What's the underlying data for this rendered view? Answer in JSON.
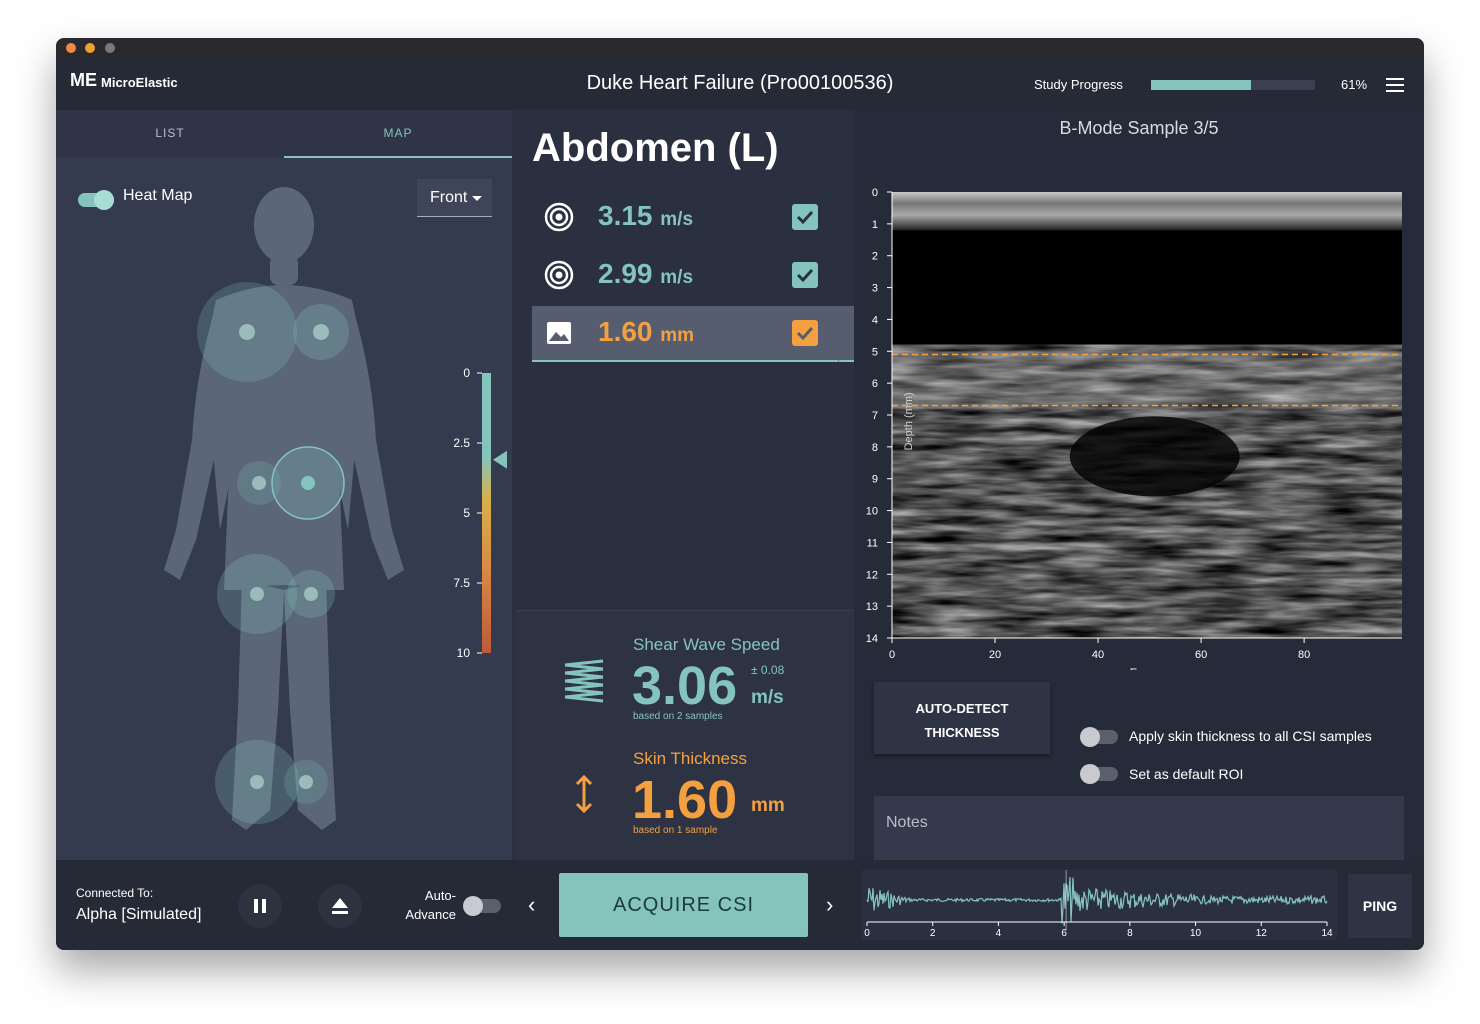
{
  "window": {
    "traffic_colors": [
      "#f08a4b",
      "#f0a030",
      "#7a7a7a"
    ]
  },
  "header": {
    "logo_mark": "ME",
    "brand": "MicroElastic",
    "study_title": "Duke Heart Failure (Pro00100536)",
    "progress_label": "Study Progress",
    "progress_value": 0.61,
    "progress_text": "61%",
    "menu_icon": "hamburger-menu-icon"
  },
  "left": {
    "tabs": [
      {
        "label": "LIST",
        "active": false
      },
      {
        "label": "MAP",
        "active": true
      }
    ],
    "heat_map_label": "Heat Map",
    "heat_map_on": true,
    "view_select": "Front",
    "scale_ticks": [
      "0",
      "2.5",
      "5",
      "7.5",
      "10"
    ],
    "scale_pointer_value": 3.1
  },
  "middle": {
    "region_title": "Abdomen (L)",
    "measurements": [
      {
        "icon": "target-icon",
        "value": "3.15",
        "unit": "m/s",
        "checked": true,
        "active": false
      },
      {
        "icon": "target-icon",
        "value": "2.99",
        "unit": "m/s",
        "checked": true,
        "active": false
      },
      {
        "icon": "image-icon",
        "value": "1.60",
        "unit": "mm",
        "checked": true,
        "active": true
      }
    ],
    "shear": {
      "label": "Shear Wave Speed",
      "value": "3.06",
      "plusminus": "± 0.08",
      "unit": "m/s",
      "note": "based on 2 samples"
    },
    "skin": {
      "label": "Skin Thickness",
      "value": "1.60",
      "unit": "mm",
      "note": "based on 1 sample"
    }
  },
  "right": {
    "chart_title": "B-Mode Sample 3/5",
    "y_ticks": [
      "0",
      "1",
      "2",
      "3",
      "4",
      "5",
      "6",
      "7",
      "8",
      "9",
      "10",
      "11",
      "12",
      "13",
      "14"
    ],
    "x_ticks": [
      "0",
      "20",
      "40",
      "60",
      "80"
    ],
    "x_label": "Frame",
    "y_label": "Depth (mm)",
    "auto_detect_label_1": "AUTO-DETECT",
    "auto_detect_label_2": "THICKNESS",
    "option_1": "Apply skin thickness to all CSI samples",
    "option_2": "Set as default ROI",
    "notes_label": "Notes"
  },
  "chart_data": {
    "type": "heatmap",
    "title": "B-Mode Sample 3/5",
    "xlabel": "Frame",
    "ylabel": "Depth (mm)",
    "xlim": [
      0,
      99
    ],
    "ylim": [
      0,
      14
    ],
    "x_ticks": [
      0,
      20,
      40,
      60,
      80
    ],
    "y_ticks": [
      0,
      1,
      2,
      3,
      4,
      5,
      6,
      7,
      8,
      9,
      10,
      11,
      12,
      13,
      14
    ],
    "skin_boundaries_mm": [
      5.1,
      6.7
    ]
  },
  "bottom": {
    "connected_label": "Connected To:",
    "connected_value": "Alpha [Simulated]",
    "auto_advance_1": "Auto-",
    "auto_advance_2": "Advance",
    "acquire_label": "ACQUIRE CSI",
    "ping_label": "PING",
    "wave_ticks": [
      "0",
      "2",
      "4",
      "6",
      "8",
      "10",
      "12",
      "14"
    ]
  },
  "colors": {
    "accent": "#84c4bd",
    "orange": "#f5a040",
    "panel": "#343b4e"
  }
}
